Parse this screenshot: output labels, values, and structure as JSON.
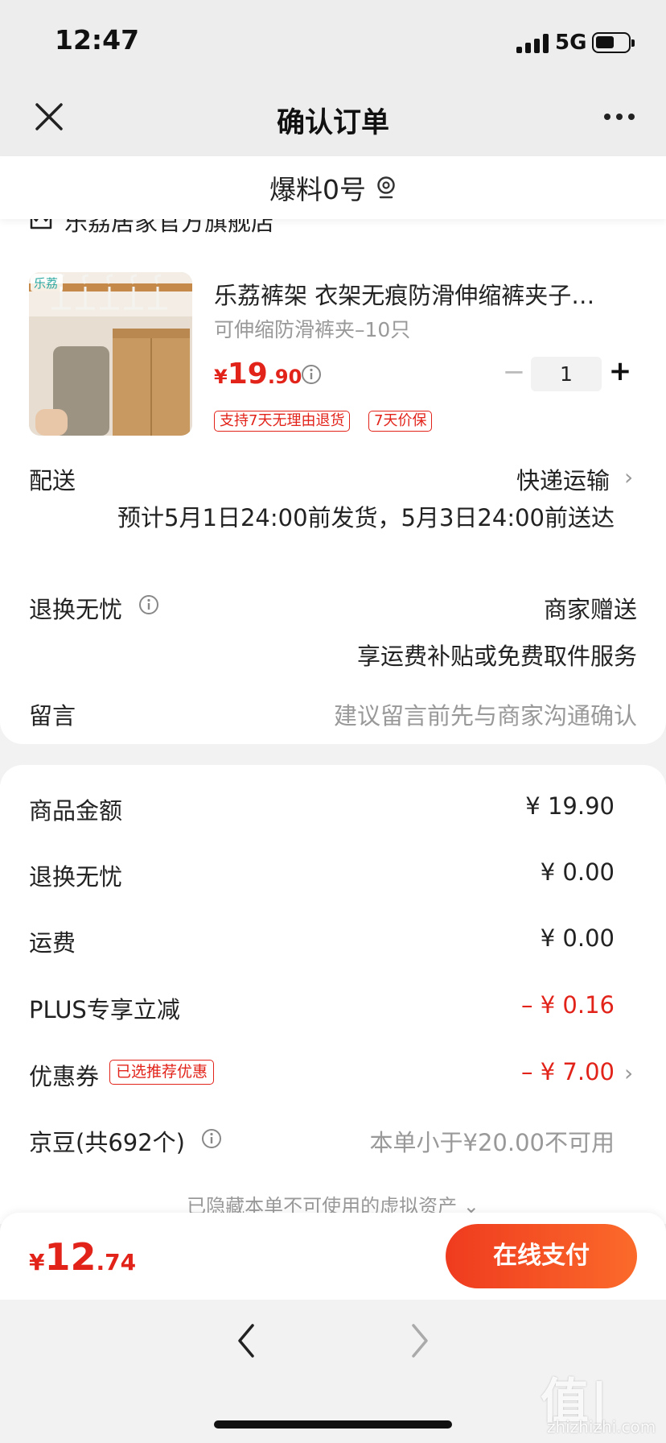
{
  "status_bar": {
    "time": "12:47",
    "network": "5G"
  },
  "nav": {
    "title": "确认订单"
  },
  "address": {
    "text": "爆料0号"
  },
  "shop": {
    "name": "乐荔居家官方旗舰店"
  },
  "product": {
    "thumbnail_brand": "乐荔",
    "title": "乐荔裤架 衣架无痕防滑伸缩裤夹子…",
    "spec": "可伸缩防滑裤夹–10只",
    "price_currency": "¥",
    "price_int": "19",
    "price_dec": ".90",
    "quantity": "1",
    "minus": "−",
    "plus": "+",
    "tags": [
      "支持7天无理由退货",
      "7天价保"
    ]
  },
  "delivery": {
    "label": "配送",
    "method": "快递运输",
    "estimate": "预计5月1日24:00前发货，5月3日24:00前送达"
  },
  "return_service": {
    "label": "退换无忧",
    "value": "商家赠送",
    "desc": "享运费补贴或免费取件服务"
  },
  "message": {
    "label": "留言",
    "placeholder": "建议留言前先与商家沟通确认"
  },
  "summary": {
    "goods_amount": {
      "label": "商品金额",
      "value": "¥ 19.90"
    },
    "return_fee": {
      "label": "退换无忧",
      "value": "¥ 0.00"
    },
    "shipping": {
      "label": "运费",
      "value": "¥ 0.00"
    },
    "plus_discount": {
      "label": "PLUS专享立减",
      "value": "– ¥ 0.16"
    },
    "coupon": {
      "label": "优惠券",
      "tag": "已选推荐优惠",
      "value": "– ¥ 7.00"
    },
    "jingdou": {
      "label": "京豆(共692个)",
      "value": "本单小于¥20.00不可用"
    },
    "hidden_assets": "已隐藏本单不可使用的虚拟资产 ⌄"
  },
  "pay_bar": {
    "total_currency": "¥",
    "total_int": "12",
    "total_dec": ".74",
    "pay_button": "在线支付"
  },
  "watermark": {
    "main": "值|值|值",
    "sub": "zhizhizhi.com"
  },
  "colors": {
    "accent": "#e2231a",
    "pay_gradient_start": "#ef3b1f",
    "pay_gradient_end": "#fb6a2a"
  }
}
